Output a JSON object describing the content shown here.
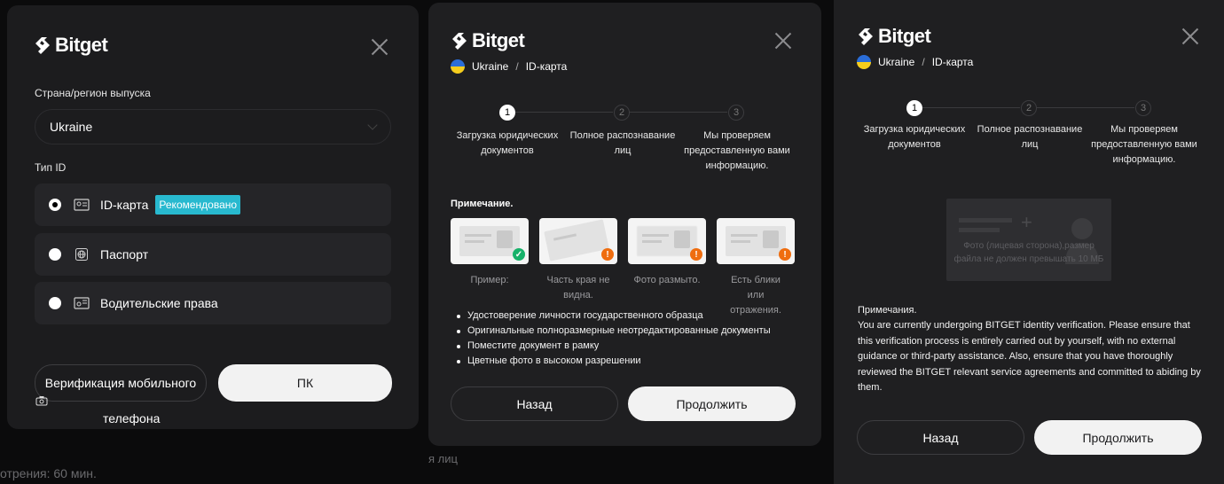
{
  "background": {
    "footer_left": "отрения: 60 мин.",
    "footer_mid": "я лиц"
  },
  "brand": {
    "name": "Bitget"
  },
  "panel1": {
    "region_label": "Страна/регион выпуска",
    "region_value": "Ukraine",
    "id_type_label": "Тип ID",
    "options": [
      {
        "label": "ID-карта",
        "badge": "Рекомендовано",
        "selected": true,
        "icon": "id-card-icon"
      },
      {
        "label": "Паспорт",
        "badge": "",
        "selected": false,
        "icon": "globe-icon"
      },
      {
        "label": "Водительские права",
        "badge": "",
        "selected": false,
        "icon": "license-icon"
      }
    ],
    "mobile_button": "Верификация мобильного",
    "mobile_button_cont": "телефона",
    "pc_button": "ПК"
  },
  "panel2": {
    "country": "Ukraine",
    "doc_type": "ID-карта",
    "steps": [
      {
        "num": "1",
        "text": "Загрузка юридических документов"
      },
      {
        "num": "2",
        "text": "Полное распознавание лиц"
      },
      {
        "num": "3",
        "text": "Мы проверяем предоставленную вами информацию."
      }
    ],
    "note_title": "Примечание.",
    "examples": [
      {
        "caption": "Пример:",
        "status": "ok"
      },
      {
        "caption": "Часть края не видна.",
        "status": "warn"
      },
      {
        "caption": "Фото размыто.",
        "status": "warn"
      },
      {
        "caption": "Есть блики или отражения.",
        "status": "warn"
      }
    ],
    "bullets": [
      "Удостоверение личности государственного образца",
      "Оригинальные полноразмерные неотредактированные документы",
      "Поместите документ в рамку",
      "Цветные фото в высоком разрешении"
    ],
    "back_button": "Назад",
    "continue_button": "Продолжить"
  },
  "panel3": {
    "country": "Ukraine",
    "doc_type": "ID-карта",
    "steps": [
      {
        "num": "1",
        "text": "Загрузка юридических документов"
      },
      {
        "num": "2",
        "text": "Полное распознавание лиц"
      },
      {
        "num": "3",
        "text": "Мы проверяем предоставленную вами информацию."
      }
    ],
    "upload_hint": "Фото (лицевая сторона),размер файла не должен превышать 10 MБ",
    "notes_title": "Примечания.",
    "notes_text": "You are currently undergoing BITGET identity verification. Please ensure that this verification process is entirely carried out by yourself, with no external guidance or third-party assistance. Also, ensure that you have thoroughly reviewed the BITGET relevant service agreements and committed to abiding by them.",
    "back_button": "Назад",
    "continue_button": "Продолжить"
  },
  "colors": {
    "accent_badge": "#28b9cf",
    "ok": "#17b26a",
    "warn": "#ef6d0f"
  }
}
